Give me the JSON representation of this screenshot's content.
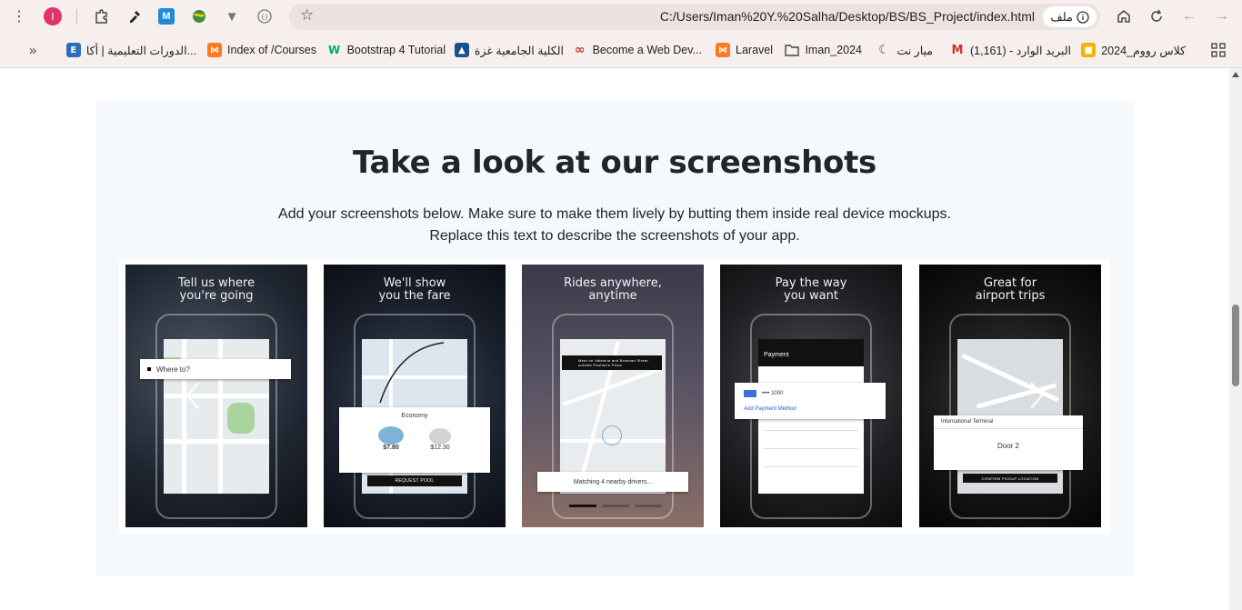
{
  "browser": {
    "url": "C:/Users/Iman%20Y.%20Salha/Desktop/BS/BS_Project/index.html",
    "site_chip_label": "ملف",
    "profile_initial": "I",
    "accent": "#e0336b"
  },
  "bookmarks": [
    {
      "label": "كلاس رووم_2024",
      "icon": "classroom-icon",
      "color": "#f4b400"
    },
    {
      "label": "البريد الوارد - (1,161)",
      "icon": "gmail-icon",
      "color": "#d93025"
    },
    {
      "label": "ميار نت",
      "icon": "crescent-icon",
      "color": "#555555"
    },
    {
      "label": "Iman_2024",
      "icon": "folder-icon",
      "color": "#444444"
    },
    {
      "label": "Laravel",
      "icon": "xampp-icon",
      "color": "#fb7a24"
    },
    {
      "label": "Become a Web Dev...",
      "icon": "udemy-icon",
      "color": "#c0392b"
    },
    {
      "label": "الكلية الجامعية غزة",
      "icon": "college-icon",
      "color": "#1b4f8a"
    },
    {
      "label": "Bootstrap 4 Tutorial",
      "icon": "w3-icon",
      "color": "#04aa6d"
    },
    {
      "label": "Index of /Courses",
      "icon": "xampp-icon",
      "color": "#fb7a24"
    },
    {
      "label": "الدورات التعليمية | أكا...",
      "icon": "e-icon",
      "color": "#2a6ebb"
    }
  ],
  "section": {
    "title": "Take a look at our screenshots",
    "description_line1": "Add your screenshots below. Make sure to make them lively by butting them inside real device mockups.",
    "description_line2": "Replace this text to describe the screenshots of your app.",
    "background": "#f5f9fc"
  },
  "screenshots": [
    {
      "caption_l1": "Tell us where",
      "caption_l2": "you're going",
      "overlay": "Where to?"
    },
    {
      "caption_l1": "We'll show",
      "caption_l2": "you the fare",
      "overlay": "Economy",
      "price_1": "$7.80",
      "price_2": "$12.30",
      "button": "REQUEST POOL"
    },
    {
      "caption_l1": "Rides anywhere,",
      "caption_l2": "anytime",
      "overlay": "Meet on Valencia and Brannan Street outside Pauline's Pizza",
      "status": "Matching 4 nearby drivers..."
    },
    {
      "caption_l1": "Pay the way",
      "caption_l2": "you want",
      "overlay": "Payment",
      "card_number": "•••• 1000",
      "link": "Add Payment Method"
    },
    {
      "caption_l1": "Great for",
      "caption_l2": "airport trips",
      "overlay": "International Terminal",
      "option": "Door 2",
      "button": "CONFIRM PICKUP LOCATION"
    }
  ]
}
